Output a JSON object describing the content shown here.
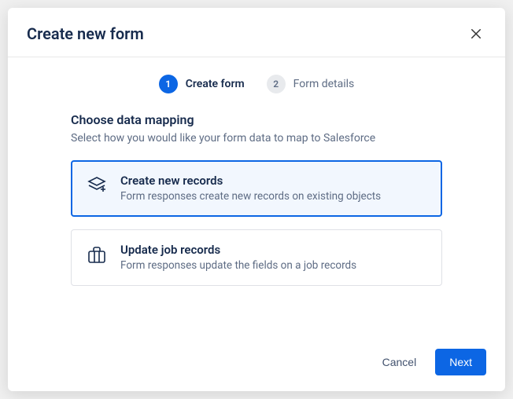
{
  "modal": {
    "title": "Create new form"
  },
  "stepper": {
    "steps": [
      {
        "num": "1",
        "label": "Create form"
      },
      {
        "num": "2",
        "label": "Form details"
      }
    ]
  },
  "section": {
    "title": "Choose data mapping",
    "subtitle": "Select how you would like your form data to map to Salesforce"
  },
  "options": [
    {
      "title": "Create new records",
      "desc": "Form responses create new records on existing objects"
    },
    {
      "title": "Update job records",
      "desc": "Form responses update the fields on a job records"
    }
  ],
  "footer": {
    "cancel": "Cancel",
    "next": "Next"
  }
}
